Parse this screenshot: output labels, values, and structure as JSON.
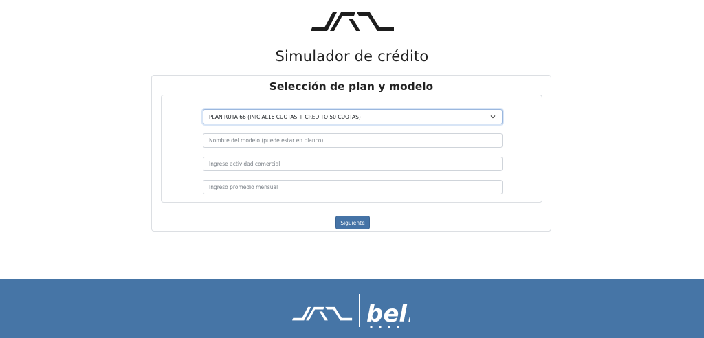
{
  "brand": {
    "header_logo": "jac-logo",
    "footer_logos": [
      "jac-logo",
      "bel-logo"
    ],
    "footer_logo_text": "bel!",
    "accent_color": "#4675a6",
    "button_color": "#4573a6"
  },
  "page": {
    "title": "Simulador de crédito"
  },
  "form": {
    "section_title": "Selección de plan y modelo",
    "plan_select": {
      "value": "PLAN RUTA 66 (INICIAL16 CUOTAS + CREDITO 50 CUOTAS)",
      "icon": "chevron-down-icon"
    },
    "model_input": {
      "value": "",
      "placeholder": "Nombre del modelo (puede estar en blanco)"
    },
    "activity_input": {
      "value": "",
      "placeholder": "Ingrese actividad comercial"
    },
    "income_input": {
      "value": "",
      "placeholder": "Ingreso promedio mensual"
    },
    "next_label": "Siguiente"
  }
}
